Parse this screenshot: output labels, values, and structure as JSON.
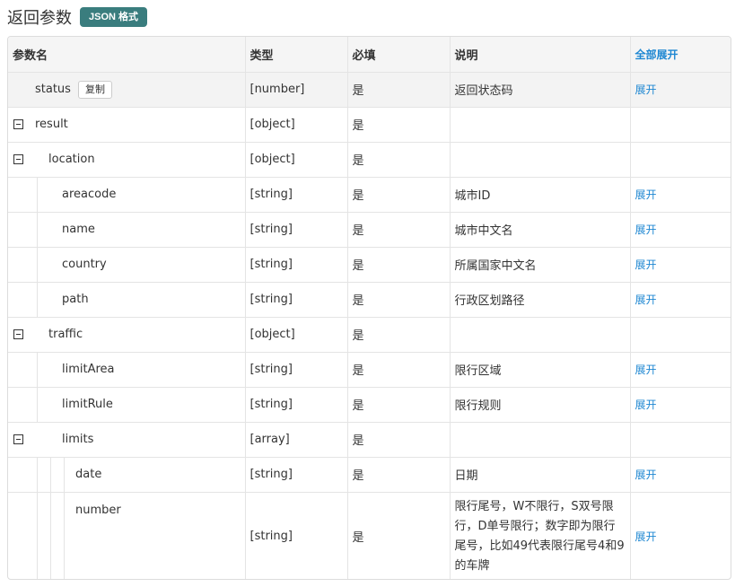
{
  "header": {
    "title": "返回参数",
    "badge": "JSON 格式"
  },
  "table": {
    "columns": {
      "name": "参数名",
      "type": "类型",
      "required": "必填",
      "description": "说明",
      "expand_all": "全部展开"
    },
    "copy_label": "复制",
    "rows": [
      {
        "name": "status",
        "type": "[number]",
        "required": "是",
        "description": "返回状态码",
        "action": "展开"
      },
      {
        "name": "result",
        "type": "[object]",
        "required": "是",
        "description": "",
        "action": ""
      },
      {
        "name": "location",
        "type": "[object]",
        "required": "是",
        "description": "",
        "action": ""
      },
      {
        "name": "areacode",
        "type": "[string]",
        "required": "是",
        "description": "城市ID",
        "action": "展开"
      },
      {
        "name": "name",
        "type": "[string]",
        "required": "是",
        "description": "城市中文名",
        "action": "展开"
      },
      {
        "name": "country",
        "type": "[string]",
        "required": "是",
        "description": "所属国家中文名",
        "action": "展开"
      },
      {
        "name": "path",
        "type": "[string]",
        "required": "是",
        "description": "行政区划路径",
        "action": "展开"
      },
      {
        "name": "traffic",
        "type": "[object]",
        "required": "是",
        "description": "",
        "action": ""
      },
      {
        "name": "limitArea",
        "type": "[string]",
        "required": "是",
        "description": "限行区域",
        "action": "展开"
      },
      {
        "name": "limitRule",
        "type": "[string]",
        "required": "是",
        "description": "限行规则",
        "action": "展开"
      },
      {
        "name": "limits",
        "type": "[array]",
        "required": "是",
        "description": "",
        "action": ""
      },
      {
        "name": "date",
        "type": "[string]",
        "required": "是",
        "description": "日期",
        "action": "展开"
      },
      {
        "name": "number",
        "type": "[string]",
        "required": "是",
        "description": "限行尾号，W不限行，S双号限行，D单号限行；数字即为限行尾号，比如49代表限行尾号4和9的车牌",
        "action": "展开"
      }
    ]
  }
}
